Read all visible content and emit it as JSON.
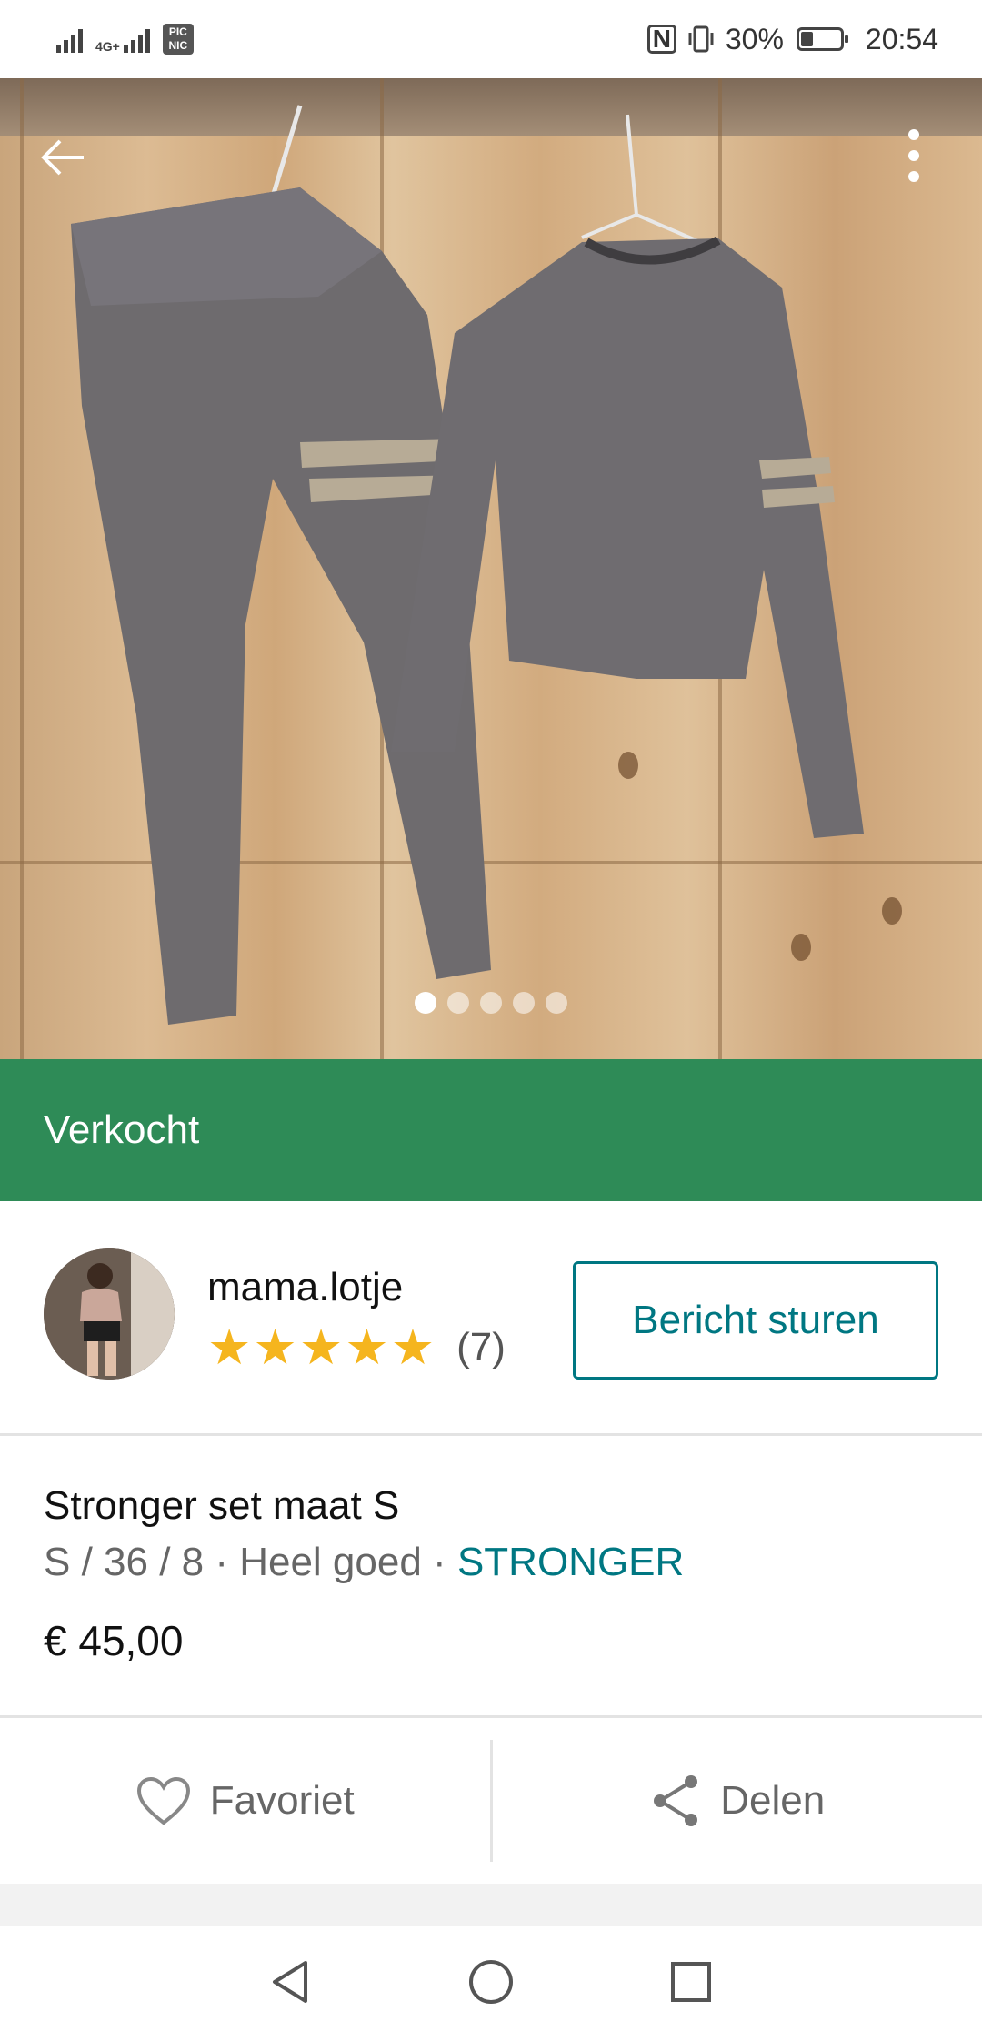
{
  "status_bar": {
    "network_label": "4G+",
    "picnic_label": "PIC NIC",
    "battery_percent": "30%",
    "battery_level": 0.3,
    "time": "20:54"
  },
  "photo": {
    "page_count": 5,
    "active_page": 1,
    "back_icon": "arrow-left-icon",
    "menu_icon": "more-vertical-icon"
  },
  "status_banner": {
    "label": "Verkocht",
    "color": "#2e8b57"
  },
  "seller": {
    "username": "mama.lotje",
    "rating_stars": 5,
    "review_count": "(7)",
    "message_button": "Bericht sturen"
  },
  "item": {
    "title": "Stronger set maat S",
    "size": "S / 36 / 8",
    "sep1": " · ",
    "condition": "Heel goed",
    "sep2": " · ",
    "brand": "STRONGER",
    "price": "€ 45,00"
  },
  "actions": {
    "favorite_label": "Favoriet",
    "share_label": "Delen"
  },
  "colors": {
    "accent": "#007782",
    "sold": "#2e8b57",
    "star": "#f5b51e"
  }
}
